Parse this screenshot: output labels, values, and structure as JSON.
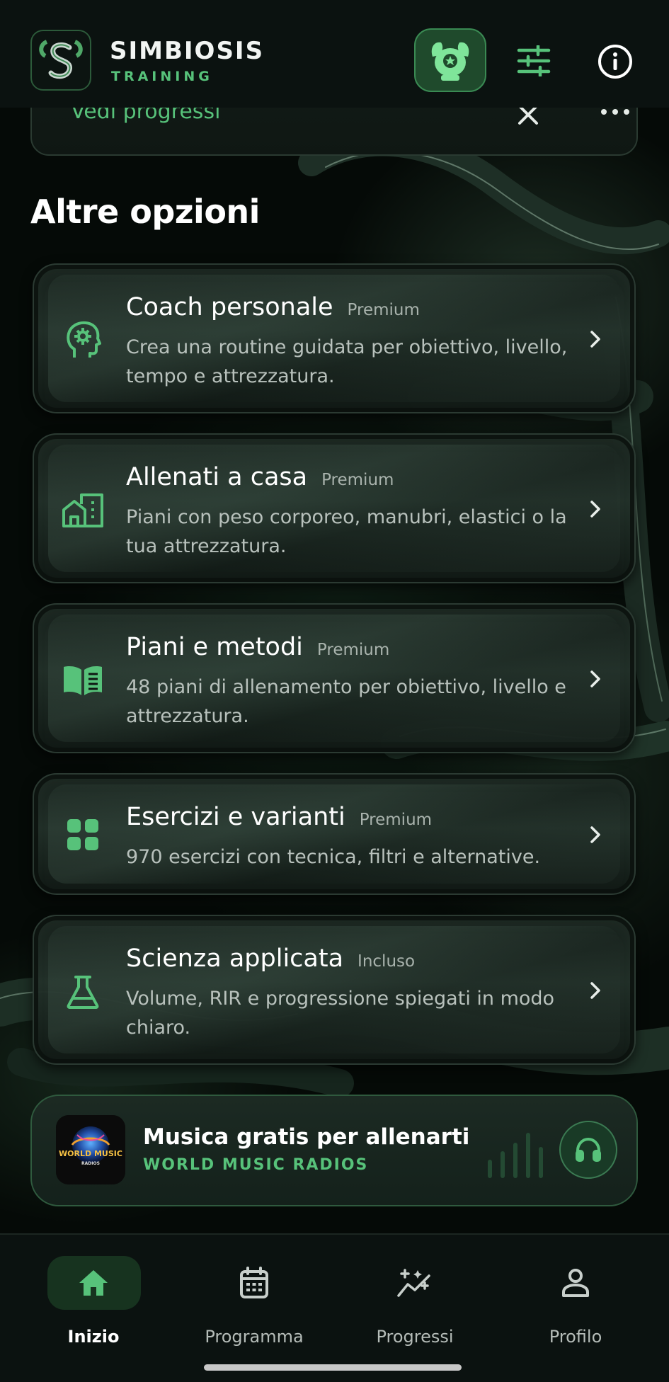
{
  "colors": {
    "accent": "#57c27a",
    "background": "#060c09",
    "card_border": "#2b3a32",
    "text_primary": "#ffffff",
    "text_secondary": "#b8c1bc"
  },
  "header": {
    "brand_name": "SIMBIOSIS",
    "brand_sub": "TRAINING",
    "icons": [
      "simbiosis-logo",
      "mascot-icon",
      "filter-sliders-icon",
      "info-icon"
    ]
  },
  "previous_card": {
    "label": "Vedi progressi",
    "icons": [
      "close-icon",
      "more-icon"
    ]
  },
  "section": {
    "title": "Altre opzioni"
  },
  "options": [
    {
      "title": "Coach personale",
      "badge": "Premium",
      "description": "Crea una routine guidata per obiettivo, livello, tempo e attrezzatura.",
      "icon": "brain-head-icon"
    },
    {
      "title": "Allenati a casa",
      "badge": "Premium",
      "description": "Piani con peso corporeo, manubri, elastici o la tua attrezzatura.",
      "icon": "home-building-icon"
    },
    {
      "title": "Piani e metodi",
      "badge": "Premium",
      "description": "48 piani di allenamento per obiettivo, livello e attrezzatura.",
      "icon": "open-book-icon"
    },
    {
      "title": "Esercizi e varianti",
      "badge": "Premium",
      "description": "970 esercizi con tecnica, filtri e alternative.",
      "icon": "grid-icon"
    },
    {
      "title": "Scienza applicata",
      "badge": "Incluso",
      "description": "Volume, RIR e progressione spiegati in modo chiaro.",
      "icon": "flask-icon"
    }
  ],
  "music": {
    "title": "Musica gratis per allenarti",
    "subtitle": "WORLD MUSIC RADIOS",
    "logo_text": "WORLD MUSIC",
    "logo_subtext": "RADIOS",
    "icon": "headphones-icon"
  },
  "bottom_nav": {
    "items": [
      {
        "label": "Inizio",
        "icon": "home-icon",
        "active": true
      },
      {
        "label": "Programma",
        "icon": "calendar-icon",
        "active": false
      },
      {
        "label": "Progressi",
        "icon": "sparkle-chart-icon",
        "active": false
      },
      {
        "label": "Profilo",
        "icon": "person-icon",
        "active": false
      }
    ]
  }
}
